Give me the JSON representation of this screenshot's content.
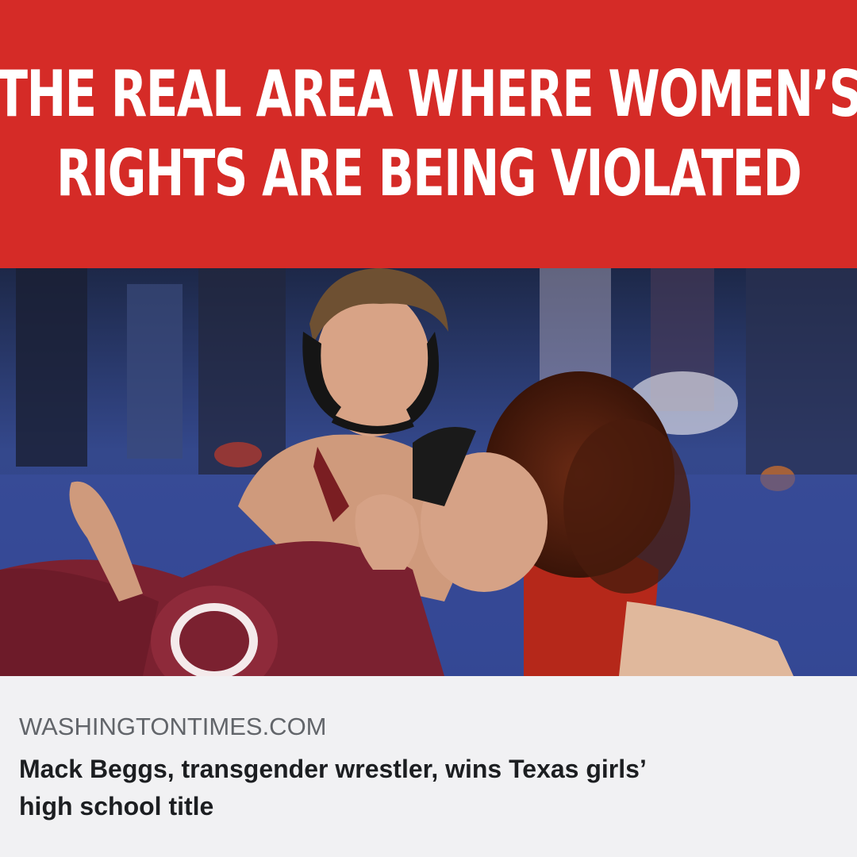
{
  "banner": {
    "line1": "THE REAL AREA WHERE WOMEN’S",
    "line2": "RIGHTS ARE BEING VIOLATED",
    "background_color": "#d52b27",
    "text_color": "#ffffff"
  },
  "link_preview": {
    "source": "WASHINGTONTIMES.COM",
    "title_line1": "Mack Beggs, transgender wrestler, wins Texas girls’",
    "title_line2": "high school title"
  },
  "photo": {
    "icon": "wrestling-photo"
  }
}
